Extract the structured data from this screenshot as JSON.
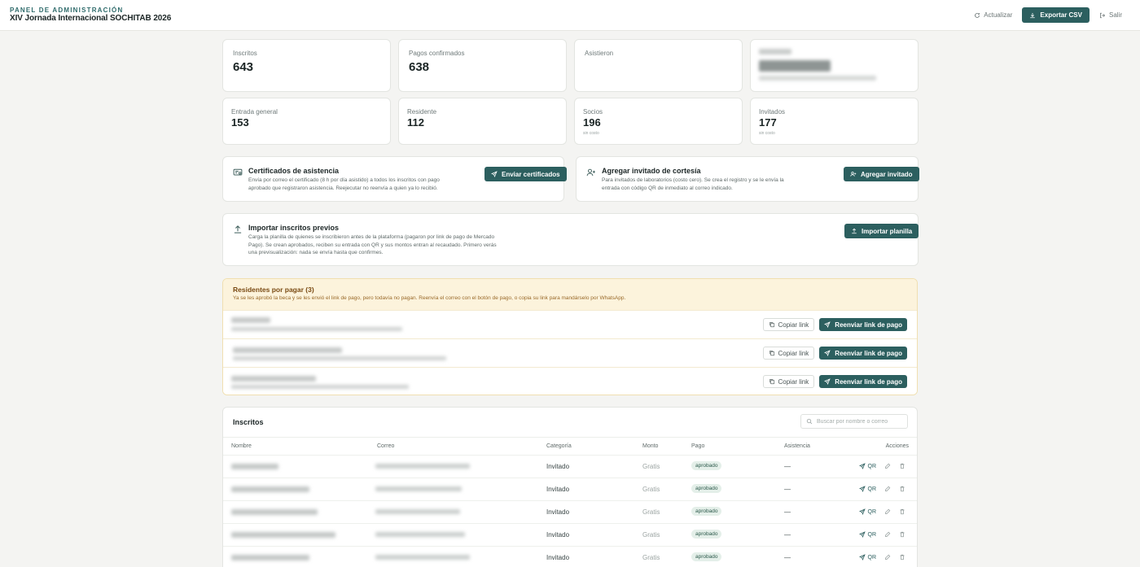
{
  "header": {
    "eyebrow": "PANEL DE ADMINISTRACIÓN",
    "title": "XIV Jornada Internacional SOCHITAB 2026",
    "refresh_label": "Actualizar",
    "export_label": "Exportar CSV",
    "logout_label": "Salir"
  },
  "stats": {
    "inscritos": {
      "label": "Inscritos",
      "value": "643"
    },
    "pagos": {
      "label": "Pagos confirmados",
      "value": "638"
    },
    "asistieron": {
      "label": "Asistieron",
      "value": ""
    },
    "general": {
      "label": "Entrada general",
      "value": "153"
    },
    "residente": {
      "label": "Residente",
      "value": "112"
    },
    "socios": {
      "label": "Socios",
      "value": "196",
      "note": "sin costo"
    },
    "invitados": {
      "label": "Invitados",
      "value": "177",
      "note": "sin costo"
    }
  },
  "certificados": {
    "title": "Certificados de asistencia",
    "desc_1": "Envía por correo el certificado (8 h por día asistido) a todos los inscritos con pago",
    "desc_2": "aprobado que registraron asistencia. Reejecutar no reenvía a quien ya lo recibió.",
    "button": "Enviar certificados"
  },
  "invitado": {
    "title": "Agregar invitado de cortesía",
    "desc_1": "Para invitados de laboratorios (costo cero). Se crea el registro y se le envía la",
    "desc_2": "entrada con código QR de inmediato al correo indicado.",
    "button": "Agregar invitado"
  },
  "importar": {
    "title": "Importar inscritos previos",
    "desc_1": "Carga la planilla de quienes se inscribieron antes de la plataforma (pagaron por link de pago de Mercado",
    "desc_2": "Pago). Se crean aprobados, reciben su entrada con QR y sus montos entran al recaudado. Primero verás",
    "desc_3": "una previsualización: nada se envía hasta que confirmes.",
    "button": "Importar planilla"
  },
  "residentes": {
    "title": "Residentes por pagar (3)",
    "desc": "Ya se les aprobó la beca y se les envió el link de pago, pero todavía no pagan. Reenvía el correo con el botón de pago, o copia su link para mandárselo por WhatsApp.",
    "copy_label": "Copiar link",
    "resend_label": "Reenviar link de pago"
  },
  "inscritos_table": {
    "title": "Inscritos",
    "search_placeholder": "Buscar por nombre o correo",
    "columns": {
      "nombre": "Nombre",
      "correo": "Correo",
      "categoria": "Categoría",
      "monto": "Monto",
      "pago": "Pago",
      "asistencia": "Asistencia",
      "acciones": "Acciones"
    },
    "rows": [
      {
        "categoria": "Invitado",
        "monto": "Gratis",
        "pago": "aprobado",
        "asistencia": "—",
        "qr": "QR"
      },
      {
        "categoria": "Invitado",
        "monto": "Gratis",
        "pago": "aprobado",
        "asistencia": "—",
        "qr": "QR"
      },
      {
        "categoria": "Invitado",
        "monto": "Gratis",
        "pago": "aprobado",
        "asistencia": "—",
        "qr": "QR"
      },
      {
        "categoria": "Invitado",
        "monto": "Gratis",
        "pago": "aprobado",
        "asistencia": "—",
        "qr": "QR"
      },
      {
        "categoria": "Invitado",
        "monto": "Gratis",
        "pago": "aprobado",
        "asistencia": "—",
        "qr": "QR"
      }
    ]
  },
  "colors": {
    "primary": "#2c5f5f",
    "warn_bg": "#fcf3dc",
    "badge_bg": "#e4efe9"
  },
  "icons": [
    "refresh-icon",
    "download-icon",
    "logout-icon",
    "certificate-icon",
    "send-icon",
    "user-plus-icon",
    "upload-icon",
    "copy-icon",
    "search-icon",
    "edit-icon",
    "trash-icon"
  ]
}
